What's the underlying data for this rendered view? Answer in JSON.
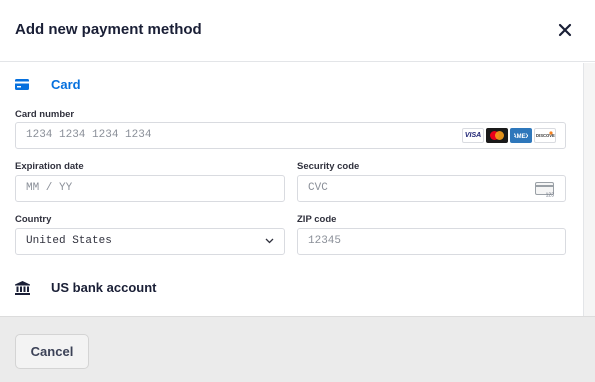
{
  "header": {
    "title": "Add new payment method",
    "close_icon": "close-icon"
  },
  "card_tab": {
    "label": "Card",
    "icon": "credit-card-icon",
    "color": "#0570de"
  },
  "card_number": {
    "label": "Card number",
    "placeholder": "1234 1234 1234 1234",
    "brands": [
      "VISA",
      "mastercard",
      "AMEX",
      "DISCOVER"
    ]
  },
  "expiration": {
    "label": "Expiration date",
    "placeholder": "MM / YY"
  },
  "security_code": {
    "label": "Security code",
    "placeholder": "CVC",
    "icon": "cvc-card-icon",
    "icon_text": "123"
  },
  "country": {
    "label": "Country",
    "value": "United States",
    "icon": "chevron-down-icon"
  },
  "zip": {
    "label": "ZIP code",
    "placeholder": "12345"
  },
  "bank_tab": {
    "label": "US bank account",
    "icon": "bank-icon"
  },
  "footer": {
    "cancel_label": "Cancel"
  }
}
